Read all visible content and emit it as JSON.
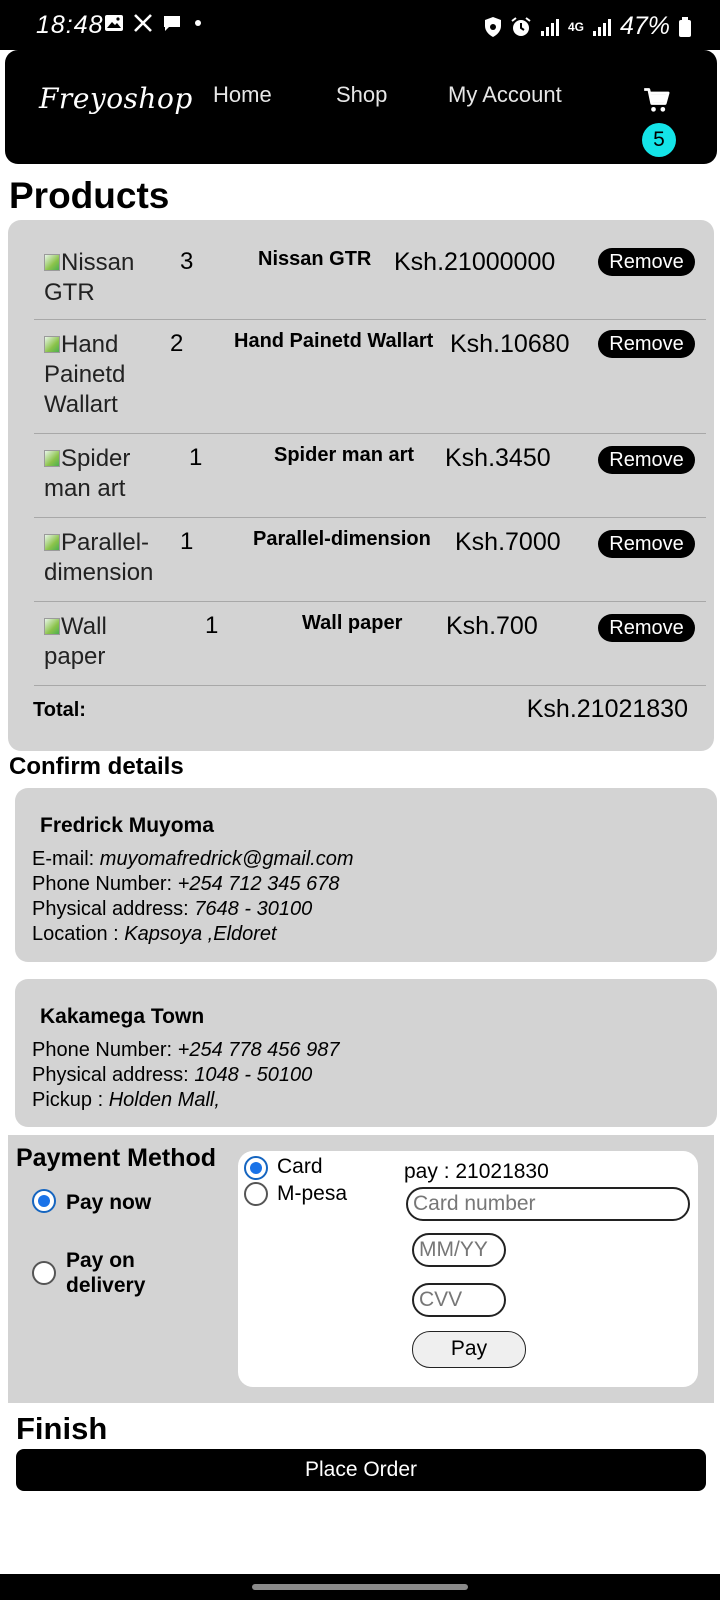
{
  "status_bar": {
    "time": "18:48",
    "battery": "47%",
    "network": "4G",
    "left_icons": [
      "gallery-icon",
      "x-icon",
      "chat-icon",
      "dot-icon"
    ],
    "right_icons": [
      "shield-icon",
      "alarm-icon",
      "signal-icon",
      "network-4g-icon",
      "signal-icon",
      "battery-icon"
    ]
  },
  "header": {
    "logo": "Freyoshop",
    "nav": [
      "Home",
      "Shop",
      "My Account"
    ],
    "cart_count": "5"
  },
  "products": {
    "title": "Products",
    "items": [
      {
        "image_alt": "Nissan GTR",
        "qty": "3",
        "name": "Nissan GTR",
        "price": "Ksh.21000000",
        "remove": "Remove"
      },
      {
        "image_alt": "Hand Painetd Wallart",
        "qty": "2",
        "name": "Hand Painetd Wallart",
        "price": "Ksh.10680",
        "remove": "Remove"
      },
      {
        "image_alt": "Spider man art",
        "qty": "1",
        "name": "Spider man art",
        "price": "Ksh.3450",
        "remove": "Remove"
      },
      {
        "image_alt": "Parallel-dimension",
        "qty": "1",
        "name": "Parallel-dimension",
        "price": "Ksh.7000",
        "remove": "Remove"
      },
      {
        "image_alt": "Wall paper",
        "qty": "1",
        "name": "Wall paper",
        "price": "Ksh.700",
        "remove": "Remove"
      }
    ],
    "total_label": "Total:",
    "total_value": "Ksh.21021830"
  },
  "confirm": {
    "title": "Confirm details",
    "user": {
      "name": "Fredrick Muyoma",
      "email_label": "E-mail:",
      "email": "muyomafredrick@gmail.com",
      "phone_label": "Phone Number:",
      "phone": "+254 712 345 678",
      "address_label": "Physical address:",
      "address": "7648 - 30100",
      "location_label": "Location :",
      "location": "Kapsoya ,Eldoret"
    },
    "pickup": {
      "name": "Kakamega Town",
      "phone_label": "Phone Number:",
      "phone": "+254 778 456 987",
      "address_label": "Physical address:",
      "address": "1048 - 50100",
      "pickup_label": "Pickup :",
      "pickup": "Holden Mall,"
    }
  },
  "payment": {
    "title": "Payment Method",
    "options": [
      "Pay now",
      "Pay on delivery"
    ],
    "selected_option": "Pay now",
    "methods": [
      "Card",
      "M-pesa"
    ],
    "selected_method": "Card",
    "pay_label": "pay : 21021830",
    "card_placeholder": "Card number",
    "expiry_placeholder": "MM/YY",
    "cvv_placeholder": "CVV",
    "pay_button": "Pay"
  },
  "finish": {
    "title": "Finish",
    "button": "Place Order"
  },
  "colors": {
    "header_bg": "#000000",
    "panel_bg": "#d3d3d3",
    "badge": "#14e4e8",
    "radio_accent": "#1a73e8"
  }
}
